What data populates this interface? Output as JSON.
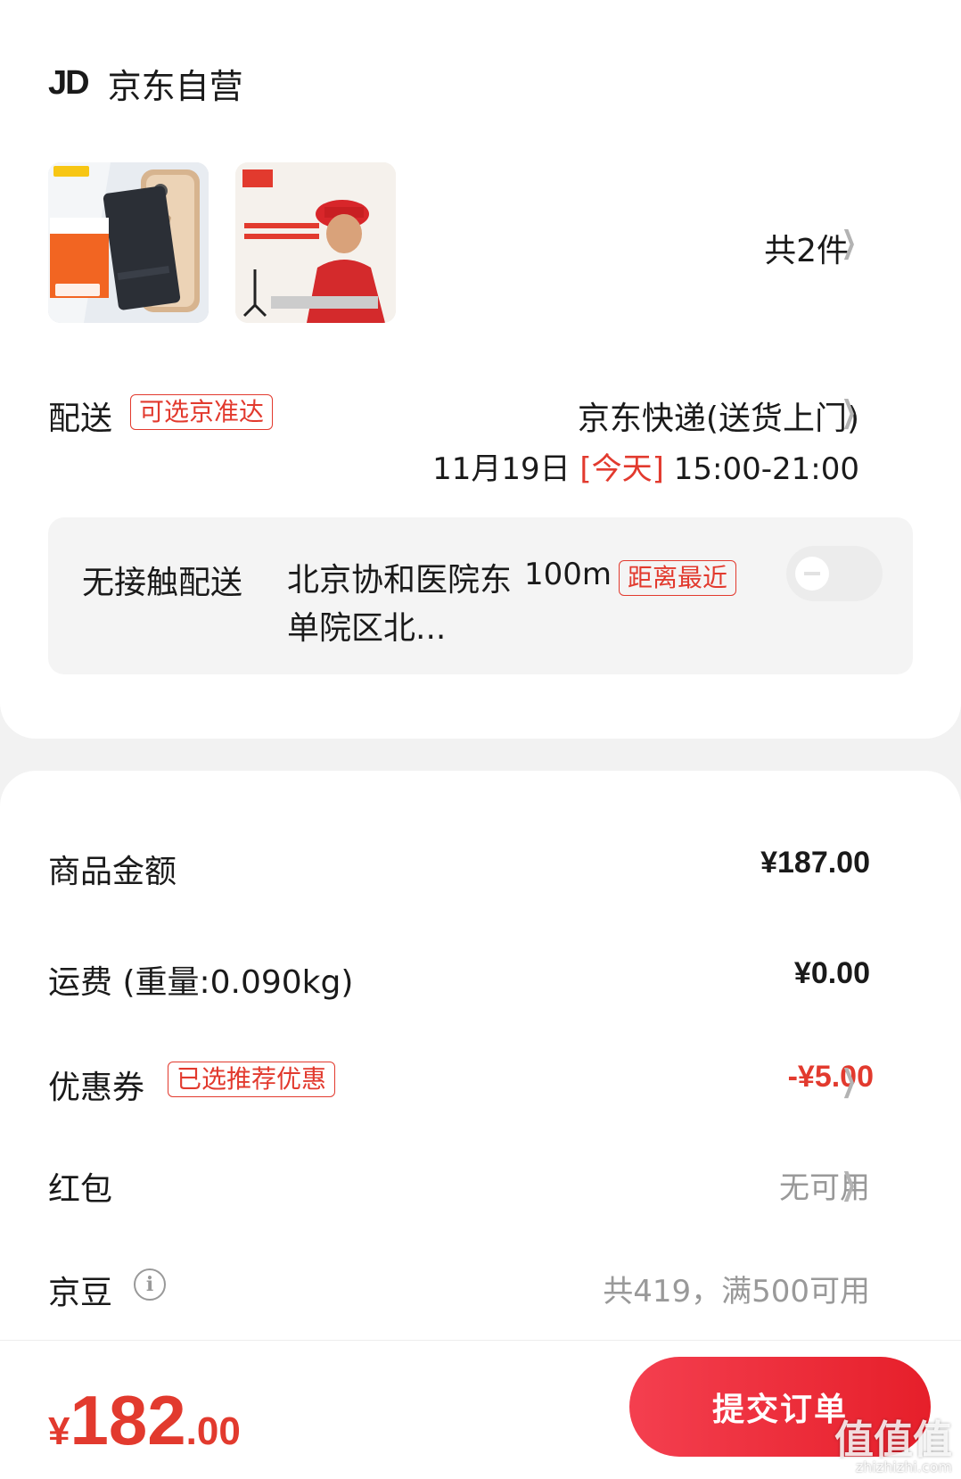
{
  "shop": {
    "logo": "JD",
    "name": "京东自营"
  },
  "products": [
    {
      "icon": "battery-product-image"
    },
    {
      "icon": "repair-service-image"
    }
  ],
  "product_count": "共2件",
  "delivery": {
    "label": "配送",
    "tag": "可选京准达",
    "method": "京东快递(送货上门)",
    "date": "11月19日",
    "today": "[今天]",
    "time": "15:00-21:00"
  },
  "contactless": {
    "label": "无接触配送",
    "address": "北京协和医院东单院区北...",
    "distance": "100m",
    "tag": "距离最近",
    "enabled": false
  },
  "summary": {
    "goods_label": "商品金额",
    "goods_value": "¥187.00",
    "shipping_label": "运费 (重量:0.090kg)",
    "shipping_value": "¥0.00",
    "coupon_label": "优惠券",
    "coupon_tag": "已选推荐优惠",
    "coupon_value": "-¥5.00",
    "redpacket_label": "红包",
    "redpacket_value": "无可用",
    "jingdou_label": "京豆",
    "jingdou_value": "共419，满500可用"
  },
  "footer": {
    "currency": "¥",
    "total_int": "182",
    "total_dec": ".00",
    "submit_label": "提交订单"
  },
  "watermark": {
    "text": "值值值",
    "url": "zhizhizhi.com"
  },
  "colors": {
    "accent": "#e23a2e",
    "button": "#ef2b38",
    "background": "#f2f2f2"
  }
}
